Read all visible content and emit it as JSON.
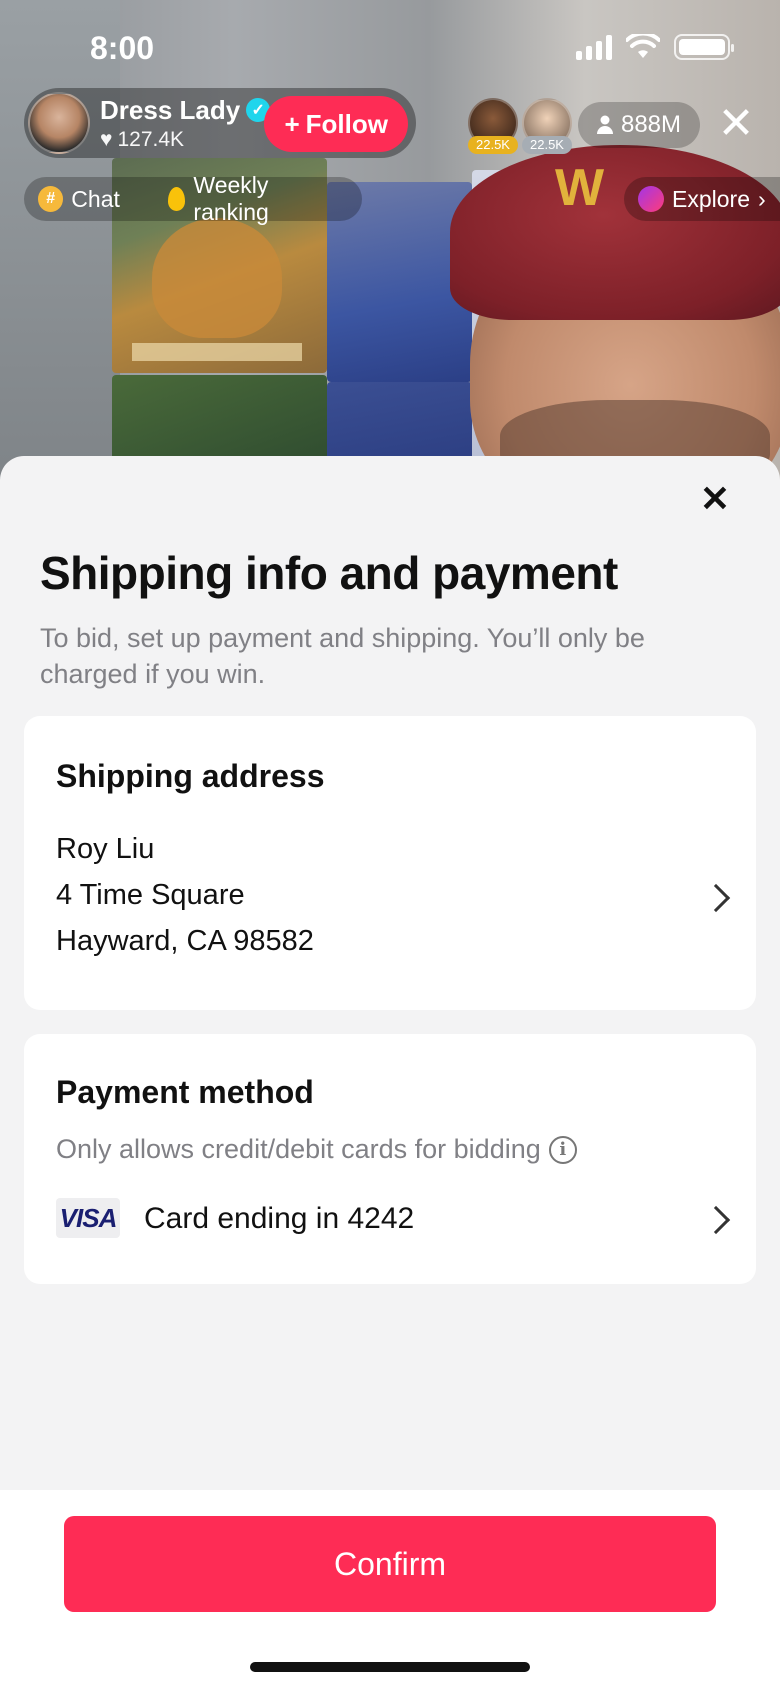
{
  "status_bar": {
    "time": "8:00"
  },
  "live": {
    "host_name": "Dress Lady",
    "host_likes": "127.4K",
    "follow_label": "Follow",
    "viewers": [
      {
        "badge": "22.5K"
      },
      {
        "badge": "22.5K"
      }
    ],
    "viewer_count": "888M",
    "chips": {
      "chat": "Chat",
      "weekly_ranking": "Weekly ranking",
      "explore": "Explore"
    }
  },
  "sheet": {
    "title": "Shipping info and payment",
    "subtitle": "To bid, set up payment and shipping. You’ll only be charged if you win.",
    "shipping": {
      "title": "Shipping address",
      "name": "Roy Liu",
      "line1": "4 Time Square",
      "line2": "Hayward, CA 98582"
    },
    "payment": {
      "title": "Payment method",
      "note": "Only allows credit/debit cards for bidding",
      "card_brand": "VISA",
      "card_text": "Card ending in 4242"
    },
    "confirm_label": "Confirm"
  },
  "colors": {
    "accent": "#fe2c55",
    "verified": "#20d5ec",
    "sheet_bg": "#f3f3f4"
  }
}
